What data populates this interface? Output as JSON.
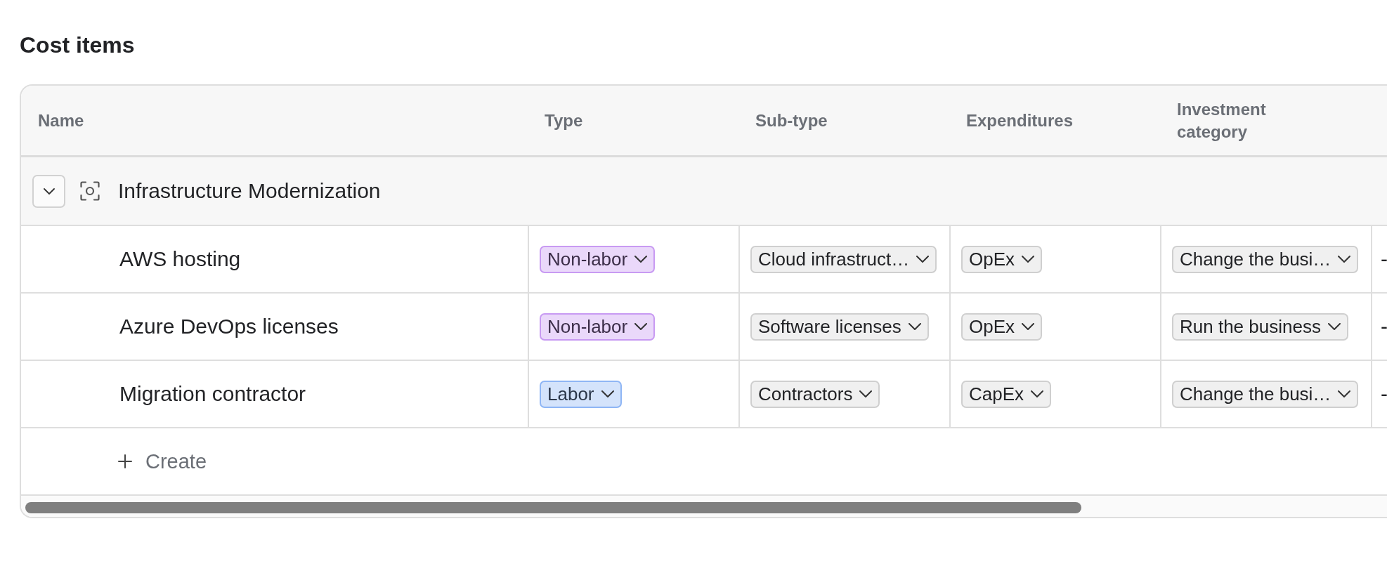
{
  "title": "Cost items",
  "table": {
    "columns": [
      "Name",
      "Type",
      "Sub-type",
      "Expenditures",
      "Investment category"
    ],
    "groups": [
      {
        "name": "Infrastructure Modernization",
        "expanded": true,
        "rows": [
          {
            "name": "AWS hosting",
            "type": {
              "label": "Non-labor",
              "color": "#ead8fa"
            },
            "sub_type": "Cloud infrastruct…",
            "expenditures": "OpEx",
            "investment_category": "Change the busi…",
            "column_6": "-"
          },
          {
            "name": "Azure DevOps licenses",
            "type": {
              "label": "Non-labor",
              "color": "#ead8fa"
            },
            "sub_type": "Software licenses",
            "expenditures": "OpEx",
            "investment_category": "Run the business",
            "column_6": "-"
          },
          {
            "name": "Migration contractor",
            "type": {
              "label": "Labor",
              "color": "#d4e3fb"
            },
            "sub_type": "Contractors",
            "expenditures": "CapEx",
            "investment_category": "Change the busi…",
            "column_6": "-"
          }
        ]
      }
    ],
    "create_label": "Create"
  }
}
